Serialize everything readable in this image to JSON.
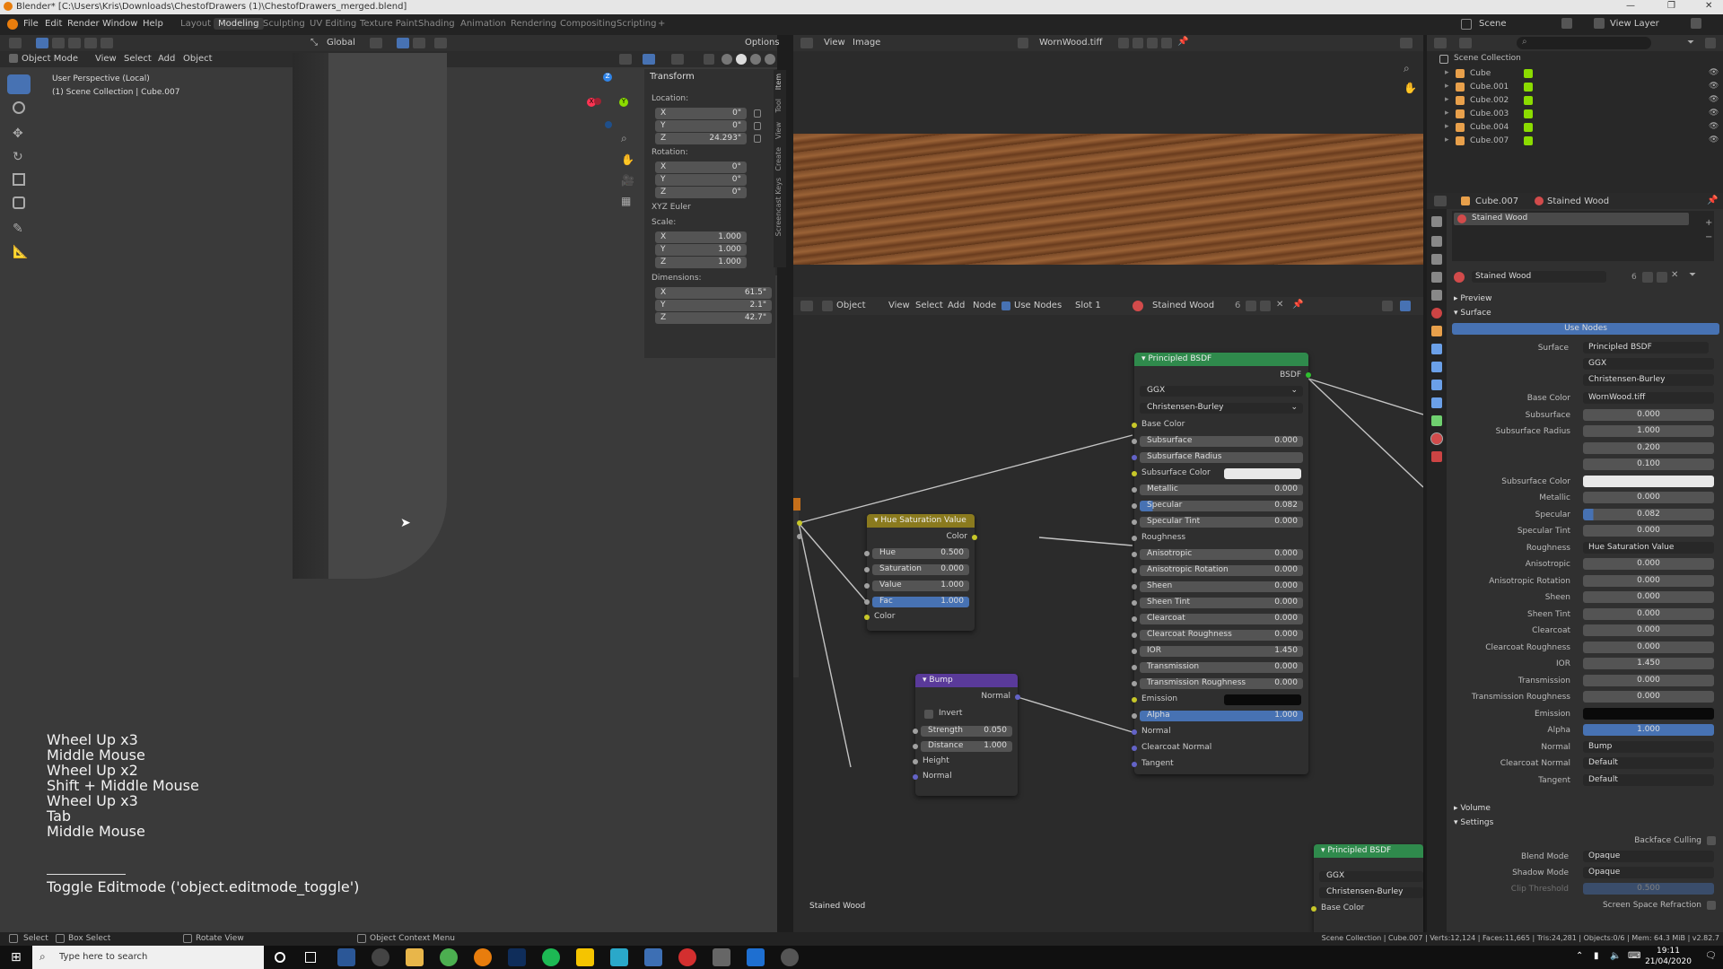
{
  "title_bar": {
    "text": "Blender* [C:\\Users\\Kris\\Downloads\\ChestofDrawers (1)\\ChestofDrawers_merged.blend]",
    "controls": [
      "—",
      "❐",
      "✕"
    ]
  },
  "menu": [
    "File",
    "Edit",
    "Render",
    "Window",
    "Help"
  ],
  "workspaces": [
    "Layout",
    "Modeling",
    "Sculpting",
    "UV Editing",
    "Texture Paint",
    "Shading",
    "Animation",
    "Rendering",
    "Compositing",
    "Scripting"
  ],
  "active_workspace": "Modeling",
  "scene": {
    "name": "Scene",
    "view_layer": "View Layer"
  },
  "viewport": {
    "mode": "Object Mode",
    "menus": [
      "View",
      "Select",
      "Add",
      "Object"
    ],
    "orientation": "Global",
    "options": "Options",
    "info_line1": "User Perspective (Local)",
    "info_line2": "(1) Scene Collection | Cube.007",
    "tabs": [
      "Item",
      "Tool",
      "View",
      "Create",
      "Screencast Keys"
    ],
    "transform": {
      "header": "Transform",
      "location_label": "Location:",
      "rotation_label": "Rotation:",
      "scale_label": "Scale:",
      "dimensions_label": "Dimensions:",
      "euler": "XYZ Euler",
      "location": [
        {
          "axis": "X",
          "value": "0\""
        },
        {
          "axis": "Y",
          "value": "0\""
        },
        {
          "axis": "Z",
          "value": "24.293\""
        }
      ],
      "rotation": [
        {
          "axis": "X",
          "value": "0°"
        },
        {
          "axis": "Y",
          "value": "0°"
        },
        {
          "axis": "Z",
          "value": "0°"
        }
      ],
      "scale": [
        {
          "axis": "X",
          "value": "1.000"
        },
        {
          "axis": "Y",
          "value": "1.000"
        },
        {
          "axis": "Z",
          "value": "1.000"
        }
      ],
      "dimensions": [
        {
          "axis": "X",
          "value": "61.5\""
        },
        {
          "axis": "Y",
          "value": "2.1\""
        },
        {
          "axis": "Z",
          "value": "42.7\""
        }
      ]
    },
    "gizmo": {
      "x": "X",
      "y": "Y",
      "z": "Z"
    }
  },
  "screencast": {
    "keys": [
      "Wheel Up x3",
      "Middle Mouse",
      "Wheel Up x2",
      "Shift + Middle Mouse",
      "Wheel Up x3",
      "Tab",
      "Middle Mouse"
    ],
    "operator": "Toggle Editmode ('object.editmode_toggle')"
  },
  "image_editor": {
    "menus": [
      "View",
      "Image"
    ],
    "image_name": "WornWood.tiff"
  },
  "node_editor": {
    "mode": "Object",
    "menus": [
      "View",
      "Select",
      "Add",
      "Node"
    ],
    "use_nodes": "Use Nodes",
    "slot": "Slot 1",
    "material": "Stained Wood",
    "users": "6",
    "footer_label": "Stained Wood",
    "principled": {
      "title": "Principled BSDF",
      "output": "BSDF",
      "distribution": "GGX",
      "subsurface_method": "Christensen-Burley",
      "rows": [
        {
          "label": "Base Color",
          "value": "",
          "kind": "socket",
          "sock": "ylw"
        },
        {
          "label": "Subsurface",
          "value": "0.000",
          "kind": "field",
          "sock": "gry"
        },
        {
          "label": "Subsurface Radius",
          "value": "",
          "kind": "dropdown",
          "sock": "pur"
        },
        {
          "label": "Subsurface Color",
          "value": "",
          "kind": "color-white",
          "sock": "ylw"
        },
        {
          "label": "Metallic",
          "value": "0.000",
          "kind": "field",
          "sock": "gry"
        },
        {
          "label": "Specular",
          "value": "0.082",
          "kind": "field-partial",
          "sock": "gry"
        },
        {
          "label": "Specular Tint",
          "value": "0.000",
          "kind": "field",
          "sock": "gry"
        },
        {
          "label": "Roughness",
          "value": "",
          "kind": "socket",
          "sock": "gry"
        },
        {
          "label": "Anisotropic",
          "value": "0.000",
          "kind": "field",
          "sock": "gry"
        },
        {
          "label": "Anisotropic Rotation",
          "value": "0.000",
          "kind": "field",
          "sock": "gry"
        },
        {
          "label": "Sheen",
          "value": "0.000",
          "kind": "field",
          "sock": "gry"
        },
        {
          "label": "Sheen Tint",
          "value": "0.000",
          "kind": "field",
          "sock": "gry"
        },
        {
          "label": "Clearcoat",
          "value": "0.000",
          "kind": "field",
          "sock": "gry"
        },
        {
          "label": "Clearcoat Roughness",
          "value": "0.000",
          "kind": "field",
          "sock": "gry"
        },
        {
          "label": "IOR",
          "value": "1.450",
          "kind": "field",
          "sock": "gry"
        },
        {
          "label": "Transmission",
          "value": "0.000",
          "kind": "field",
          "sock": "gry"
        },
        {
          "label": "Transmission Roughness",
          "value": "0.000",
          "kind": "field",
          "sock": "gry"
        },
        {
          "label": "Emission",
          "value": "",
          "kind": "color-black",
          "sock": "ylw"
        },
        {
          "label": "Alpha",
          "value": "1.000",
          "kind": "field-blue",
          "sock": "gry"
        },
        {
          "label": "Normal",
          "value": "",
          "kind": "socket",
          "sock": "pur"
        },
        {
          "label": "Clearcoat Normal",
          "value": "",
          "kind": "socket",
          "sock": "pur"
        },
        {
          "label": "Tangent",
          "value": "",
          "kind": "socket",
          "sock": "pur"
        }
      ]
    },
    "hsv": {
      "title": "Hue Saturation Value",
      "output": "Color",
      "input_color": "Color",
      "fields": [
        {
          "label": "Hue",
          "value": "0.500"
        },
        {
          "label": "Saturation",
          "value": "0.000"
        },
        {
          "label": "Value",
          "value": "1.000"
        },
        {
          "label": "Fac",
          "value": "1.000"
        }
      ]
    },
    "bump": {
      "title": "Bump",
      "output": "Normal",
      "invert": "Invert",
      "fields": [
        {
          "label": "Strength",
          "value": "0.050"
        },
        {
          "label": "Distance",
          "value": "1.000"
        }
      ],
      "inputs": [
        "Height",
        "Normal"
      ]
    },
    "principled2": {
      "title": "Principled BSDF",
      "distribution": "GGX",
      "subsurface_method": "Christensen-Burley",
      "first_row": "Base Color"
    }
  },
  "outliner": {
    "root": "Scene Collection",
    "items": [
      "Cube",
      "Cube.001",
      "Cube.002",
      "Cube.003",
      "Cube.004",
      "Cube.007"
    ]
  },
  "properties": {
    "object": "Cube.007",
    "material": "Stained Wood",
    "slot_item": "Stained Wood",
    "material_name": "Stained Wood",
    "users": "6",
    "panels": {
      "preview": "Preview",
      "surface": "Surface",
      "volume": "Volume",
      "settings": "Settings"
    },
    "use_nodes_button": "Use Nodes",
    "surface_label": "Surface",
    "surface_value": "Principled BSDF",
    "distribution": "GGX",
    "subsurface_method": "Christensen-Burley",
    "rows": [
      {
        "label": "Base Color",
        "value": "WornWood.tiff",
        "kind": "text-link"
      },
      {
        "label": "Subsurface",
        "value": "0.000",
        "kind": "num"
      },
      {
        "label": "Subsurface Radius",
        "value": "1.000",
        "kind": "num"
      },
      {
        "label": "",
        "value": "0.200",
        "kind": "num"
      },
      {
        "label": "",
        "value": "0.100",
        "kind": "num"
      },
      {
        "label": "Subsurface Color",
        "value": "",
        "kind": "white"
      },
      {
        "label": "Metallic",
        "value": "0.000",
        "kind": "num"
      },
      {
        "label": "Specular",
        "value": "0.082",
        "kind": "num"
      },
      {
        "label": "Specular Tint",
        "value": "0.000",
        "kind": "num"
      },
      {
        "label": "Roughness",
        "value": "Hue Saturation Value",
        "kind": "text-link"
      },
      {
        "label": "Anisotropic",
        "value": "0.000",
        "kind": "num"
      },
      {
        "label": "Anisotropic Rotation",
        "value": "0.000",
        "kind": "num"
      },
      {
        "label": "Sheen",
        "value": "0.000",
        "kind": "num"
      },
      {
        "label": "Sheen Tint",
        "value": "0.000",
        "kind": "num"
      },
      {
        "label": "Clearcoat",
        "value": "0.000",
        "kind": "num"
      },
      {
        "label": "Clearcoat Roughness",
        "value": "0.000",
        "kind": "num"
      },
      {
        "label": "IOR",
        "value": "1.450",
        "kind": "num"
      },
      {
        "label": "Transmission",
        "value": "0.000",
        "kind": "num"
      },
      {
        "label": "Transmission Roughness",
        "value": "0.000",
        "kind": "num"
      },
      {
        "label": "Emission",
        "value": "",
        "kind": "black"
      },
      {
        "label": "Alpha",
        "value": "1.000",
        "kind": "blue"
      },
      {
        "label": "Normal",
        "value": "Bump",
        "kind": "text-link"
      },
      {
        "label": "Clearcoat Normal",
        "value": "Default",
        "kind": "text"
      },
      {
        "label": "Tangent",
        "value": "Default",
        "kind": "text"
      }
    ],
    "settings": {
      "backface_culling": "Backface Culling",
      "blend_mode_label": "Blend Mode",
      "blend_mode": "Opaque",
      "shadow_mode_label": "Shadow Mode",
      "shadow_mode": "Opaque",
      "clip_threshold_label": "Clip Threshold",
      "clip_threshold": "0.500",
      "screen_space_refraction": "Screen Space Refraction"
    }
  },
  "status_bar": {
    "left": [
      "Select",
      "Box Select",
      "Rotate View",
      "Object Context Menu"
    ],
    "stats": "Scene Collection | Cube.007 | Verts:12,124 | Faces:11,665 | Tris:24,281 | Objects:0/6 | Mem: 64.3 MiB | v2.82.7"
  },
  "taskbar": {
    "search_placeholder": "Type here to search",
    "time": "19:11",
    "date": "21/04/2020"
  }
}
